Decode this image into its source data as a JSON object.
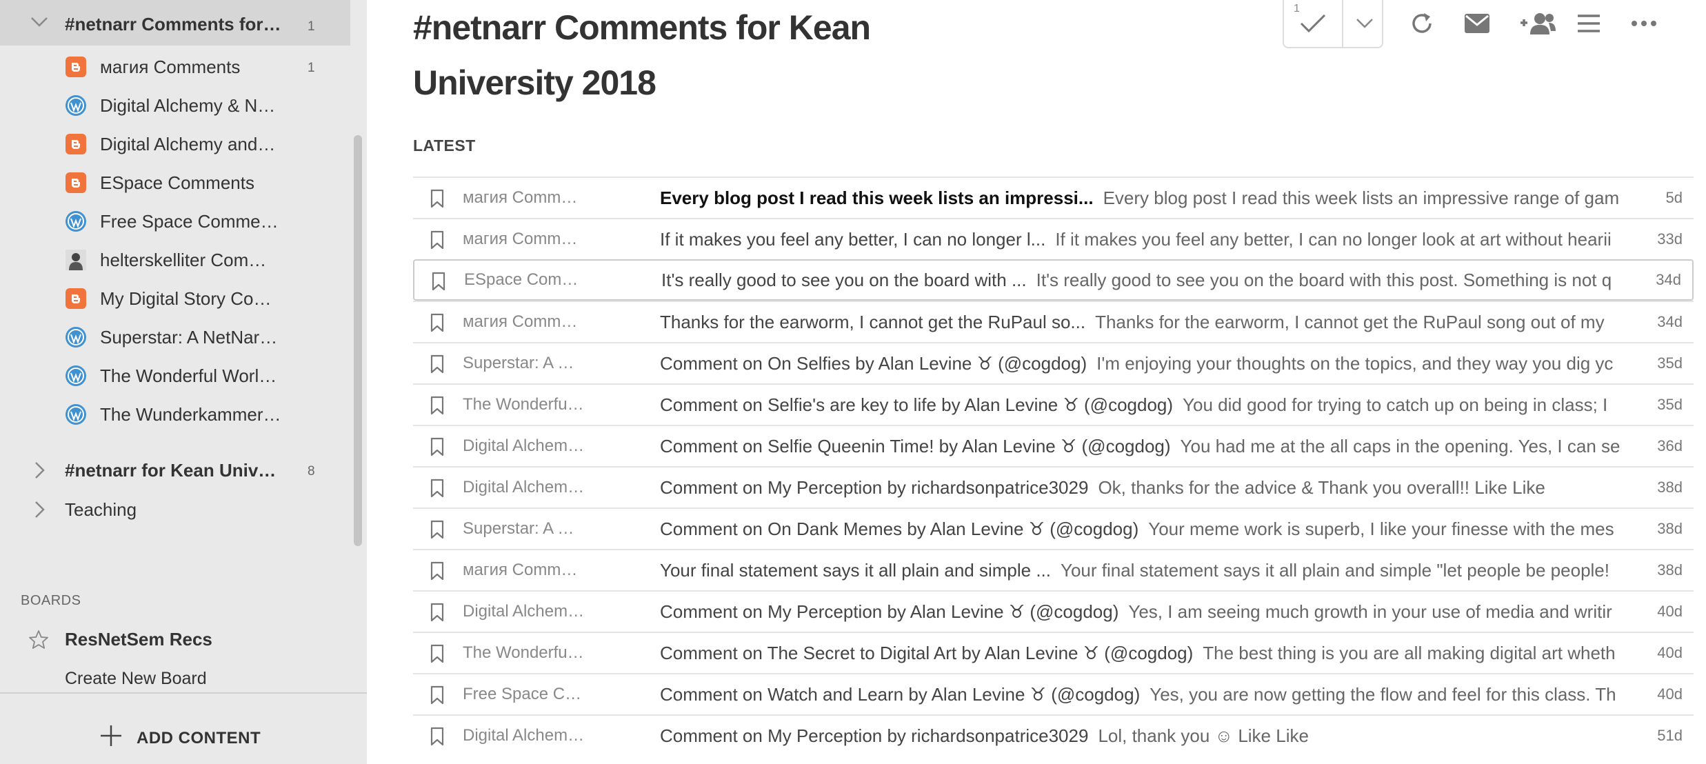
{
  "sidebar": {
    "group_expanded": {
      "title": "#netnarr Comments for…",
      "count": "1"
    },
    "feeds": [
      {
        "label": "магия Comments",
        "icon": "blogger-icon",
        "count": "1"
      },
      {
        "label": "Digital Alchemy & N…",
        "icon": "wordpress-icon",
        "count": ""
      },
      {
        "label": "Digital Alchemy and…",
        "icon": "blogger-icon",
        "count": ""
      },
      {
        "label": "ESpace Comments",
        "icon": "blogger-icon",
        "count": ""
      },
      {
        "label": "Free Space Comme…",
        "icon": "wordpress-icon",
        "count": ""
      },
      {
        "label": "helterskelliter Com…",
        "icon": "photo-avatar-icon",
        "count": ""
      },
      {
        "label": "My Digital Story Co…",
        "icon": "blogger-icon",
        "count": ""
      },
      {
        "label": "Superstar: A NetNar…",
        "icon": "wordpress-icon",
        "count": ""
      },
      {
        "label": "The Wonderful Worl…",
        "icon": "wordpress-icon",
        "count": ""
      },
      {
        "label": "The Wunderkammer…",
        "icon": "wordpress-icon",
        "count": ""
      }
    ],
    "group_collapsed": {
      "title": "#netnarr for Kean Univ…",
      "count": "8"
    },
    "teaching": "Teaching",
    "boards_label": "BOARDS",
    "board_item": "ResNetSem Recs",
    "create_board": "Create New Board",
    "add_content": "ADD CONTENT"
  },
  "main": {
    "title": "#netnarr Comments for Kean University 2018",
    "mark_read_count": "1",
    "latest_label": "LATEST",
    "entries": [
      {
        "source": "магия Comm…",
        "title": "Every blog post I read this week lists an impressi...",
        "snippet": "Every blog post I read this week lists an impressive range of gam",
        "age": "5d",
        "unread": true
      },
      {
        "source": "магия Comm…",
        "title": "If it makes you feel any better, I can no longer l...",
        "snippet": "If it makes you feel any better, I can no longer look at art without hearii",
        "age": "33d",
        "unread": false
      },
      {
        "source": "ESpace Com…",
        "title": "It's really good to see you on the board with ...",
        "snippet": "It's really good to see you on the board with this post. Something is not q",
        "age": "34d",
        "unread": false
      },
      {
        "source": "магия Comm…",
        "title": "Thanks for the earworm, I cannot get the RuPaul so...",
        "snippet": "Thanks for the earworm, I cannot get the RuPaul song out of my",
        "age": "34d",
        "unread": false
      },
      {
        "source": "Superstar: A …",
        "title": "Comment on On Selfies by Alan Levine ♉ (@cogdog)",
        "snippet": "I'm enjoying your thoughts on the topics, and they way you dig yc",
        "age": "35d",
        "unread": false
      },
      {
        "source": "The Wonderfu…",
        "title": "Comment on Selfie's are key to life by Alan Levine ♉ (@cogdog)",
        "snippet": "You did good for trying to catch up on being in class; I",
        "age": "35d",
        "unread": false
      },
      {
        "source": "Digital Alchem…",
        "title": "Comment on Selfie Queenin Time! by Alan Levine ♉ (@cogdog)",
        "snippet": "You had me at the all caps in the opening. Yes, I can se",
        "age": "36d",
        "unread": false
      },
      {
        "source": "Digital Alchem…",
        "title": "Comment on My Perception by richardsonpatrice3029",
        "snippet": "Ok, thanks for the advice & Thank you overall!! Like Like",
        "age": "38d",
        "unread": false
      },
      {
        "source": "Superstar: A …",
        "title": "Comment on On Dank Memes by Alan Levine ♉ (@cogdog)",
        "snippet": "Your meme work is superb, I like your finesse with the mes",
        "age": "38d",
        "unread": false
      },
      {
        "source": "магия Comm…",
        "title": "Your final statement says it all plain and simple ...",
        "snippet": "Your final statement says it all plain and simple \"let people be people!",
        "age": "38d",
        "unread": false
      },
      {
        "source": "Digital Alchem…",
        "title": "Comment on My Perception by Alan Levine ♉ (@cogdog)",
        "snippet": "Yes, I am seeing much growth in your use of media and writir",
        "age": "40d",
        "unread": false
      },
      {
        "source": "The Wonderfu…",
        "title": "Comment on The Secret to Digital Art by Alan Levine ♉ (@cogdog)",
        "snippet": "The best thing is you are all making digital art wheth",
        "age": "40d",
        "unread": false
      },
      {
        "source": "Free Space C…",
        "title": "Comment on Watch and Learn by Alan Levine ♉ (@cogdog)",
        "snippet": "Yes, you are now getting the flow and feel for this class. Th",
        "age": "40d",
        "unread": false
      },
      {
        "source": "Digital Alchem…",
        "title": "Comment on My Perception by richardsonpatrice3029",
        "snippet": "Lol, thank you ☺ Like Like",
        "age": "51d",
        "unread": false
      }
    ]
  }
}
